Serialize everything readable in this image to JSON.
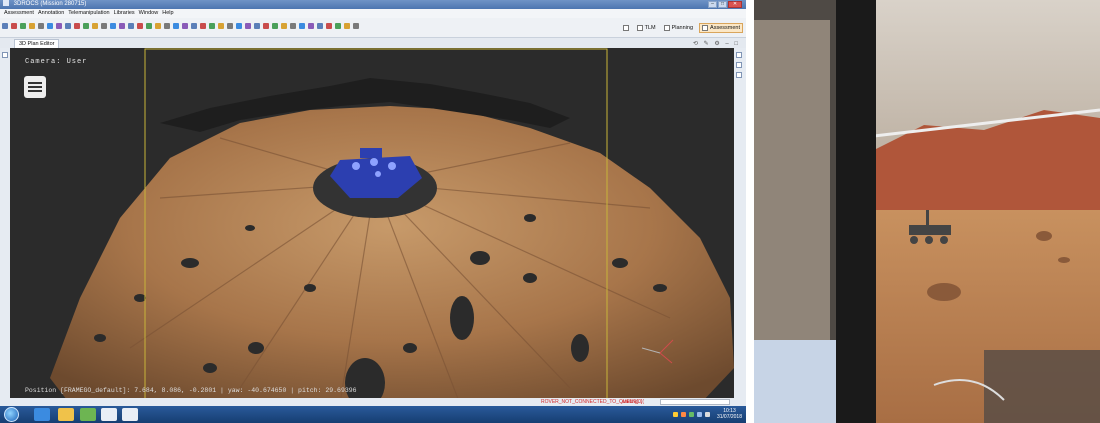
{
  "window": {
    "title": "3DROCS (Mission 280715)"
  },
  "menubar": {
    "items": [
      "Assessment",
      "Annotation",
      "Telemanipulation",
      "Libraries",
      "Window",
      "Help"
    ]
  },
  "perspectives": {
    "items": [
      {
        "label": "TLM",
        "active": false
      },
      {
        "label": "Planning",
        "active": false
      },
      {
        "label": "Assessment",
        "active": true
      }
    ]
  },
  "editor": {
    "tab_label": "3D Plan Editor",
    "camera_label": "Camera: User",
    "position_readout": "Position [FRAMEGO_default]: 7.684, 8.086, -0.2801 | yaw: -40.674650 | pitch: 29.69396"
  },
  "status": {
    "rover_message": "ROVER_NOT_CONNECTED_TO_QUEUE[0](",
    "wait_message": "waiting..."
  },
  "taskbar": {
    "time": "10:13",
    "date": "31/07/2018"
  },
  "colors": {
    "viewport_bg": "#2b2b2b",
    "terrain": "#a8754a",
    "rover_model": "#2c3fb0",
    "status_error": "#d12a2a",
    "selection_outline": "#c8b43a"
  },
  "icons": {
    "camera_menu": "hamburger-icon",
    "windows_start": "windows-start-icon",
    "browser": "internet-explorer-icon",
    "file_explorer": "folder-icon"
  }
}
